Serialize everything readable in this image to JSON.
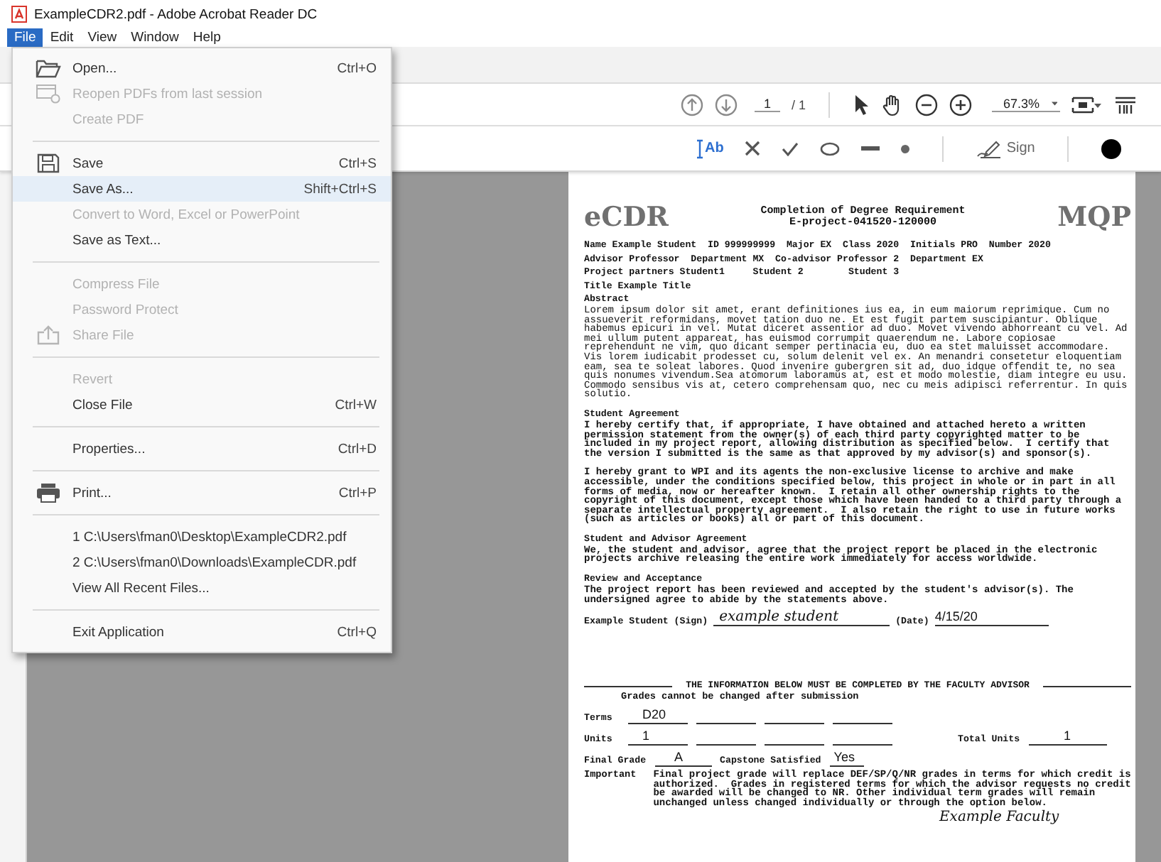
{
  "window": {
    "title": "ExampleCDR2.pdf - Adobe Acrobat Reader DC"
  },
  "menubar": [
    {
      "label": "File",
      "selected": true
    },
    {
      "label": "Edit",
      "selected": false
    },
    {
      "label": "View",
      "selected": false
    },
    {
      "label": "Window",
      "selected": false
    },
    {
      "label": "Help",
      "selected": false
    }
  ],
  "file_menu": [
    {
      "kind": "item",
      "label": "Open...",
      "shortcut": "Ctrl+O",
      "disabled": false,
      "selected": false
    },
    {
      "kind": "item",
      "label": "Reopen PDFs from last session",
      "disabled": true,
      "selected": false
    },
    {
      "kind": "item",
      "label": "Create PDF",
      "disabled": true,
      "selected": false
    },
    {
      "kind": "separator"
    },
    {
      "kind": "item",
      "label": "Save",
      "shortcut": "Ctrl+S",
      "disabled": false,
      "selected": false
    },
    {
      "kind": "item",
      "label": "Save As...",
      "shortcut": "Shift+Ctrl+S",
      "disabled": false,
      "selected": true
    },
    {
      "kind": "item",
      "label": "Convert to Word, Excel or PowerPoint",
      "disabled": true,
      "selected": false
    },
    {
      "kind": "item",
      "label": "Save as Text...",
      "disabled": false,
      "selected": false
    },
    {
      "kind": "separator"
    },
    {
      "kind": "item",
      "label": "Compress File",
      "disabled": true,
      "selected": false
    },
    {
      "kind": "item",
      "label": "Password Protect",
      "disabled": true,
      "selected": false
    },
    {
      "kind": "item",
      "label": "Share File",
      "disabled": true,
      "selected": false
    },
    {
      "kind": "separator"
    },
    {
      "kind": "item",
      "label": "Revert",
      "disabled": true,
      "selected": false
    },
    {
      "kind": "item",
      "label": "Close File",
      "shortcut": "Ctrl+W",
      "disabled": false,
      "selected": false
    },
    {
      "kind": "separator"
    },
    {
      "kind": "item",
      "label": "Properties...",
      "shortcut": "Ctrl+D",
      "disabled": false,
      "selected": false
    },
    {
      "kind": "separator"
    },
    {
      "kind": "item",
      "label": "Print...",
      "shortcut": "Ctrl+P",
      "disabled": false,
      "selected": false
    },
    {
      "kind": "separator"
    },
    {
      "kind": "item",
      "label": "1 C:\\Users\\fman0\\Desktop\\ExampleCDR2.pdf",
      "disabled": false,
      "selected": false
    },
    {
      "kind": "item",
      "label": "2 C:\\Users\\fman0\\Downloads\\ExampleCDR.pdf",
      "disabled": false,
      "selected": false
    },
    {
      "kind": "item",
      "label": "View All Recent Files...",
      "disabled": false,
      "selected": false
    },
    {
      "kind": "separator"
    },
    {
      "kind": "item",
      "label": "Exit Application",
      "shortcut": "Ctrl+Q",
      "disabled": false,
      "selected": false
    }
  ],
  "page_nav": {
    "page": "1",
    "total": "/ 1",
    "zoom": "67.3%"
  },
  "annotation_tools": {
    "text_tool": "Ab",
    "sign": "Sign"
  },
  "document": {
    "logo": "eCDR",
    "title_lines": [
      "Completion of Degree Requirement",
      "E-project-041520-120000"
    ],
    "type": "MQP",
    "info_lines": [
      "Name Example Student  ID 999999999  Major EX  Class 2020  Initials PRO  Number 2020",
      "Advisor Professor  Department MX  Co-advisor Professor 2  Department EX",
      "Project partners Student1     Student 2        Student 3",
      "Title Example Title"
    ],
    "sections": [
      {
        "heading": "Abstract",
        "paragraphs": [
          {
            "bold": false,
            "text": "Lorem ipsum dolor sit amet, erant definitiones ius ea, in eum maiorum reprimique. Cum no assueverit reformidans, movet tation duo ne. Et est fugit partem suscipiantur. Oblique habemus epicuri in vel. Mutat diceret assentior ad duo. Movet vivendo abhorreant cu vel. Ad mei ullum putent appareat, has euismod corrumpit quaerendum ne. Labore copiosae reprehendunt ne vim, quo dicant semper pertinacia eu, duo ea stet maluisset accommodare. Vis lorem iudicabit prodesset cu, solum delenit vel ex. An menandri consetetur eloquentiam eam, sea te soleat labores. Quod invenire gubergren sit ad, duo idque offendit te, no sea quis nonumes vivendum.Sea atomorum laboramus at, est et modo molestie, diam integre eu usu. Commodo sensibus vis at, cetero comprehensam quo, nec cu meis adipisci referrentur. In quis solutio."
          }
        ]
      },
      {
        "heading": "Student Agreement",
        "paragraphs": [
          {
            "bold": true,
            "text": "I hereby certify that, if appropriate, I have obtained and attached hereto a written permission statement from the owner(s) of each third party copyrighted matter to be included in my project report, allowing distribution as specified below.  I certify that the version I submitted is the same as that approved by my advisor(s) and sponsor(s)."
          },
          {
            "bold": true,
            "text": "I hereby grant to WPI and its agents the non-exclusive license to archive and make accessible, under the conditions specified below, this project in whole or in part in all forms of media, now or hereafter known.  I retain all other ownership rights to the copyright of this document, except those which have been handed to a third party through a separate intellectual property agreement.  I also retain the right to use in future works (such as articles or books) all or part of this document."
          }
        ]
      },
      {
        "heading": "Student and Advisor Agreement",
        "paragraphs": [
          {
            "bold": true,
            "text": "We, the student and advisor, agree that the project report be placed in the electronic projects archive releasing the entire work immediately for access worldwide."
          }
        ]
      },
      {
        "heading": "Review and Acceptance",
        "paragraphs": [
          {
            "bold": true,
            "text": "The project report has been reviewed and accepted by the student's advisor(s). The undersigned agree to abide by the statements above."
          }
        ]
      }
    ],
    "student_signature": {
      "label": "Example Student (Sign)",
      "signature": "example student",
      "date_label": "(Date)",
      "date": "4/15/20"
    },
    "advisor_section": {
      "banner": "THE INFORMATION BELOW MUST BE COMPLETED BY THE FACULTY ADVISOR",
      "note": "Grades cannot be changed after submission",
      "terms": {
        "label": "Terms",
        "values": [
          "D20"
        ]
      },
      "units": {
        "label": "Units",
        "values": [
          "1"
        ],
        "total_label": "Total Units",
        "total": "1"
      },
      "final_grade": {
        "label": "Final Grade",
        "value": "A"
      },
      "capstone": {
        "label": "Capstone Satisfied",
        "value": "Yes"
      },
      "important": {
        "label": "Important",
        "text": "Final project grade will replace DEF/SP/Q/NR grades in terms for which credit is authorized.  Grades in registered terms for which the advisor requests no credit be awarded will be changed to NR. Other individual term grades will remain unchanged unless changed individually or through the option below."
      },
      "faculty_signature": "Example Faculty"
    }
  }
}
